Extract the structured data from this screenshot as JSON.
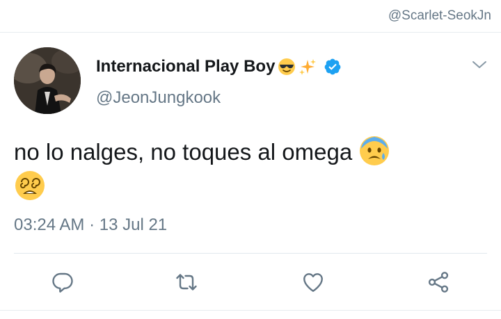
{
  "watermark": "@Scarlet-SeokJn",
  "tweet": {
    "display_name": "Internacional Play Boy",
    "name_emojis": [
      "sunglasses-face-emoji",
      "sparkles-emoji"
    ],
    "verified": true,
    "handle": "@JeonJungkook",
    "text": "no lo nalges, no toques al omega",
    "text_emojis": [
      "anxious-face-with-sweat-emoji",
      "dizzy-face-emoji"
    ],
    "timestamp": "03:24 AM · 13 Jul 21"
  },
  "actions": [
    "reply-icon",
    "retweet-icon",
    "like-icon",
    "share-icon"
  ],
  "colors": {
    "text": "#14171a",
    "secondary": "#657786",
    "verified": "#1da1f2",
    "divider": "#e6ecf0"
  }
}
